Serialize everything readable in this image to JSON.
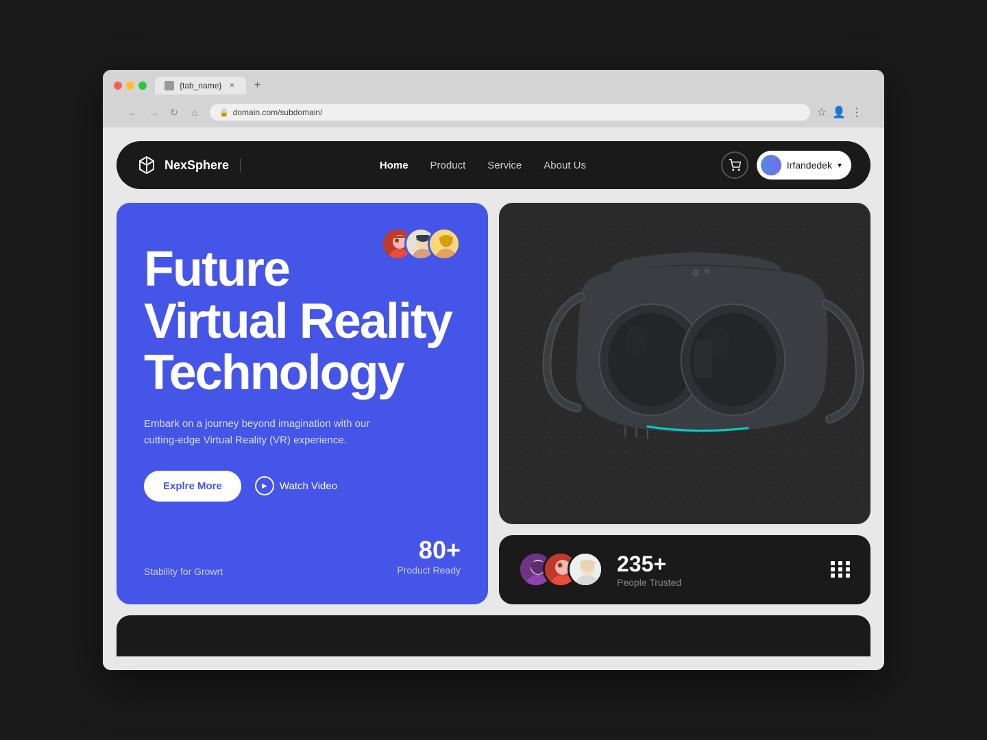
{
  "browser": {
    "tab_name": "{tab_name}",
    "url": "domain.com/subdomain/",
    "back_btn": "←",
    "forward_btn": "→",
    "refresh_btn": "↻",
    "home_btn": "⌂"
  },
  "navbar": {
    "logo_text": "NexSphere",
    "nav_items": [
      {
        "label": "Home",
        "active": true
      },
      {
        "label": "Product",
        "active": false
      },
      {
        "label": "Service",
        "active": false
      },
      {
        "label": "About Us",
        "active": false
      }
    ],
    "user_name": "Irfandedek"
  },
  "hero": {
    "title_line1": "Future",
    "title_line2": "Virtual Reality",
    "title_line3": "Technology",
    "subtitle": "Embark on a journey beyond imagination with our cutting-edge Virtual Reality (VR) experience.",
    "btn_explore": "Explre More",
    "btn_video": "Watch Video",
    "stability_text": "Stability for Growrt",
    "stats_number": "80+",
    "stats_label": "Product Ready"
  },
  "trusted": {
    "number": "235+",
    "label": "People Trusted"
  }
}
